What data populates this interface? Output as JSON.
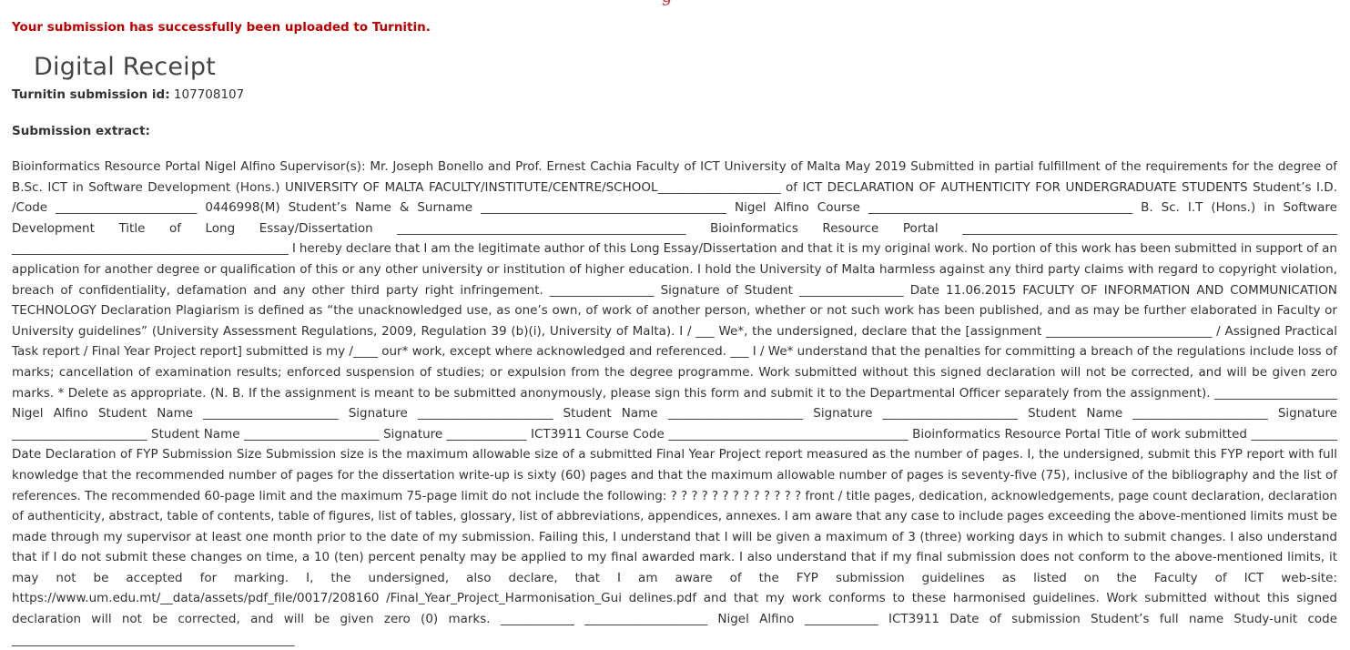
{
  "header": {
    "top_fragment": "g"
  },
  "banner": {
    "success_message": "Your submission has successfully been uploaded to Turnitin."
  },
  "receipt": {
    "title": "Digital Receipt",
    "submission_id_label": "Turnitin submission id:",
    "submission_id": "107708107",
    "extract_label": "Submission extract:",
    "extract_text": "Bioinformatics Resource Portal Nigel Alfino Supervisor(s): Mr. Joseph Bonello and Prof. Ernest Cachia Faculty of ICT University of Malta May 2019 Submitted in partial fulfillment of the requirements for the degree of B.Sc. ICT in Software Development (Hons.) UNIVERSITY OF MALTA FACULTY/INSTITUTE/CENTRE/SCHOOL____________________ of ICT DECLARATION OF AUTHENTICITY FOR UNDERGRADUATE STUDENTS Student’s I.D. /Code _______________________ 0446998(M) Student’s Name & Surname ________________________________________ Nigel Alfino Course ___________________________________________ B. Sc. I.T (Hons.) in Software Development Title of Long Essay/Dissertation _______________________________________________ Bioinformatics Resource Portal _____________________________________________________________ _____________________________________________ I hereby declare that I am the legitimate author of this Long Essay/Dissertation and that it is my original work. No portion of this work has been submitted in support of an application for another degree or qualification of this or any other university or institution of higher education. I hold the University of Malta harmless against any third party claims with regard to copyright violation, breach of confidentiality, defamation and any other third party right infringement. _________________ Signature of Student _________________ Date 11.06.2015 FACULTY OF INFORMATION AND COMMUNICATION TECHNOLOGY Declaration Plagiarism is defined as “the unacknowledged use, as one’s own, of work of another person, whether or not such work has been published, and as may be further elaborated in Faculty or University guidelines” (University Assessment Regulations, 2009, Regulation 39 (b)(i), University of Malta). I / ___ We*, the undersigned, declare that the [assignment ___________________________ / Assigned Practical Task report / Final Year Project report] submitted is my /____ our* work, except where acknowledged and referenced. ___ I / We* understand that the penalties for committing a breach of the regulations include loss of marks; cancellation of examination results; enforced suspension of studies; or expulsion from the degree programme. Work submitted without this signed declaration will not be corrected, and will be given zero marks. * Delete as appropriate. (N. B. If the assignment is meant to be submitted anonymously, please sign this form and submit it to the Departmental Officer separately from the assignment). ____________________ Nigel Alfino Student Name ______________________ Signature ______________________ Student Name ______________________ Signature ______________________ Student Name ______________________ Signature ______________________ Student Name ______________________ Signature _____________ ICT3911 Course Code _______________________________________ Bioinformatics Resource Portal Title of work submitted ______________ Date Declaration of FYP Submission Size Submission size is the maximum allowable size of a submitted Final Year Project report measured as the number of pages. I, the undersigned, submit this FYP report with full knowledge that the recommended number of pages for the dissertation write-up is sixty (60) pages and that the maximum allowable number of pages is seventy-five (75), inclusive of the bibliography and the list of references. The recommended 60-page limit and the maximum 75-page limit do not include the following: ? ? ? ? ? ? ? ? ? ? ? ? ? front / title pages, dedication, acknowledgements, page count declaration, declaration of authenticity, abstract, table of contents, table of figures, list of tables, glossary, list of abbreviations, appendices, annexes. I am aware that any case to include pages exceeding the above-mentioned limits must be made through my supervisor at least one month prior to the date of my submission. Failing this, I understand that I will be given a maximum of 3 (three) working days in which to submit changes. I also understand that if I do not submit these changes on time, a 10 (ten) percent penalty may be applied to my final awarded mark. I also understand that if my final submission does not conform to the above-mentioned limits, it may not be accepted for marking. I, the undersigned, also declare, that I am aware of the FYP submission guidelines as listed on the Faculty of ICT web-site: https://www.um.edu.mt/__data/assets/pdf_file/0017/208160 /Final_Year_Project_Harmonisation_Gui delines.pdf and that my work conforms to these harmonised guidelines. Work submitted without this signed declaration will not be corrected, and will be given zero (0) marks. ____________ ____________________ Nigel Alfino ____________ ICT3911 Date of submission Student’s full name Study-unit code ______________________________________________"
  },
  "colors": {
    "success": "#c00000",
    "text": "#333333",
    "title": "#444444"
  }
}
